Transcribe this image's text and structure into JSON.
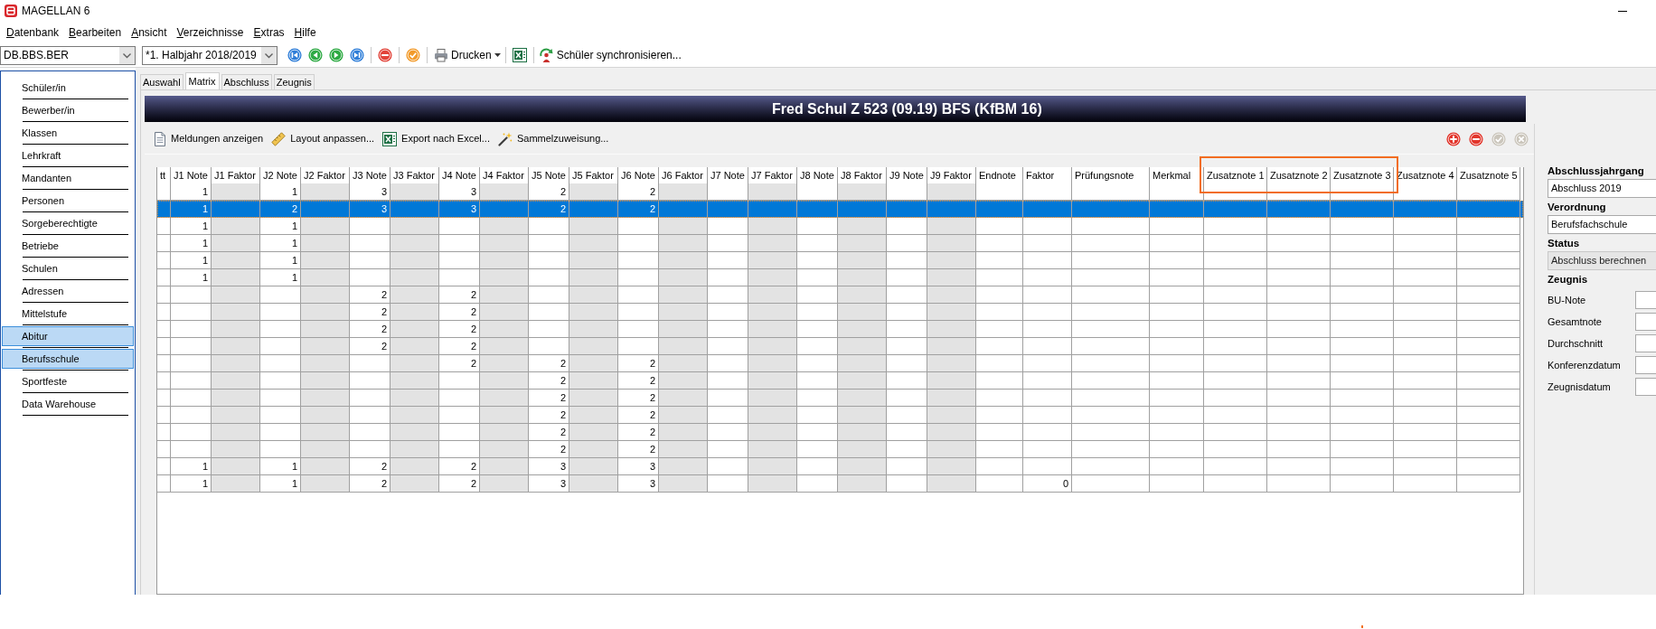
{
  "window": {
    "title": "MAGELLAN 6"
  },
  "menu": [
    "Datenbank",
    "Bearbeiten",
    "Ansicht",
    "Verzeichnisse",
    "Extras",
    "Hilfe"
  ],
  "toolbar": {
    "selects": [
      {
        "value": "DB.BBS.BER"
      },
      {
        "value": "*1. Halbjahr 2018/2019"
      }
    ],
    "buttons": [
      {
        "kind": "first"
      },
      {
        "kind": "previous"
      },
      {
        "kind": "next"
      },
      {
        "kind": "last"
      },
      {
        "kind": "stop"
      },
      {
        "kind": "confirm"
      },
      {
        "kind": "print",
        "label": "Drucken"
      },
      {
        "kind": "excel"
      },
      {
        "kind": "sync",
        "label": "Schüler synchronisieren..."
      }
    ]
  },
  "sidebar": {
    "items": [
      {
        "label": "Schüler/in",
        "selected": false
      },
      {
        "label": "Bewerber/in",
        "selected": false
      },
      {
        "label": "Klassen",
        "selected": false
      },
      {
        "label": "Lehrkraft",
        "selected": false
      },
      {
        "label": "Mandanten",
        "selected": false
      },
      {
        "label": "Personen",
        "selected": false
      },
      {
        "label": "Sorgeberechtigte",
        "selected": false
      },
      {
        "label": "Betriebe",
        "selected": false
      },
      {
        "label": "Schulen",
        "selected": false
      },
      {
        "label": "Adressen",
        "selected": false
      },
      {
        "label": "Mittelstufe",
        "selected": false
      },
      {
        "label": "Abitur",
        "selected": true
      },
      {
        "label": "Berufsschule",
        "selected": true
      },
      {
        "label": "Sportfeste",
        "selected": false
      },
      {
        "label": "Data Warehouse",
        "selected": false
      }
    ]
  },
  "tabs": [
    {
      "label": "Auswahl",
      "selected": false
    },
    {
      "label": "Matrix",
      "selected": true
    },
    {
      "label": "Abschluss",
      "selected": false
    },
    {
      "label": "Zeugnis",
      "selected": false
    }
  ],
  "header": {
    "title": "Fred Schul Z 523 (09.19) BFS (KfBM 16)"
  },
  "grid_toolbar": {
    "actions": [
      {
        "kind": "messages",
        "label": "Meldungen anzeigen"
      },
      {
        "kind": "layout",
        "label": "Layout anpassen..."
      },
      {
        "kind": "excel",
        "label": "Export nach Excel..."
      },
      {
        "kind": "assign",
        "label": "Sammelzuweisung..."
      }
    ],
    "row_buttons": [
      {
        "kind": "add",
        "disabled": false
      },
      {
        "kind": "remove",
        "disabled": false
      },
      {
        "kind": "confirm",
        "disabled": true
      },
      {
        "kind": "cancel",
        "disabled": true
      }
    ]
  },
  "grid": {
    "columns": [
      {
        "label": "tt",
        "shaded": false,
        "annotated": false
      },
      {
        "label": "J1 Note",
        "shaded": false,
        "annotated": false
      },
      {
        "label": "J1 Faktor",
        "shaded": true,
        "annotated": false
      },
      {
        "label": "J2 Note",
        "shaded": false,
        "annotated": false
      },
      {
        "label": "J2 Faktor",
        "shaded": true,
        "annotated": false
      },
      {
        "label": "J3 Note",
        "shaded": false,
        "annotated": false
      },
      {
        "label": "J3 Faktor",
        "shaded": true,
        "annotated": false
      },
      {
        "label": "J4 Note",
        "shaded": false,
        "annotated": false
      },
      {
        "label": "J4 Faktor",
        "shaded": true,
        "annotated": false
      },
      {
        "label": "J5 Note",
        "shaded": false,
        "annotated": false
      },
      {
        "label": "J5 Faktor",
        "shaded": true,
        "annotated": false
      },
      {
        "label": "J6 Note",
        "shaded": false,
        "annotated": false
      },
      {
        "label": "J6 Faktor",
        "shaded": true,
        "annotated": false
      },
      {
        "label": "J7 Note",
        "shaded": false,
        "annotated": false
      },
      {
        "label": "J7 Faktor",
        "shaded": true,
        "annotated": false
      },
      {
        "label": "J8 Note",
        "shaded": false,
        "annotated": false
      },
      {
        "label": "J8 Faktor",
        "shaded": true,
        "annotated": false
      },
      {
        "label": "J9 Note",
        "shaded": false,
        "annotated": false
      },
      {
        "label": "J9 Faktor",
        "shaded": true,
        "annotated": false
      },
      {
        "label": "Endnote",
        "shaded": false,
        "annotated": false
      },
      {
        "label": "Faktor",
        "shaded": false,
        "annotated": false
      },
      {
        "label": "Prüfungsnote",
        "shaded": false,
        "annotated": false
      },
      {
        "label": "Merkmal",
        "shaded": false,
        "annotated": false
      },
      {
        "label": "Zusatznote 1",
        "shaded": false,
        "annotated": true
      },
      {
        "label": "Zusatznote 2",
        "shaded": false,
        "annotated": true
      },
      {
        "label": "Zusatznote 3",
        "shaded": false,
        "annotated": true
      },
      {
        "label": "Zusatznote 4",
        "shaded": false,
        "annotated": false
      },
      {
        "label": "Zusatznote 5",
        "shaded": false,
        "annotated": false
      }
    ],
    "rows": [
      {
        "selected": false,
        "j1_note": "1",
        "j2_note": "1",
        "j3_note": "3",
        "j4_note": "3",
        "j5_note": "2",
        "j6_note": "2"
      },
      {
        "selected": true,
        "j1_note": "1",
        "j2_note": "2",
        "j3_note": "3",
        "j4_note": "3",
        "j5_note": "2",
        "j6_note": "2"
      },
      {
        "selected": false,
        "j1_note": "1",
        "j2_note": "1"
      },
      {
        "selected": false,
        "j1_note": "1",
        "j2_note": "1"
      },
      {
        "selected": false,
        "j1_note": "1",
        "j2_note": "1"
      },
      {
        "selected": false,
        "j1_note": "1",
        "j2_note": "1"
      },
      {
        "selected": false,
        "j3_note": "2",
        "j4_note": "2"
      },
      {
        "selected": false,
        "j3_note": "2",
        "j4_note": "2"
      },
      {
        "selected": false,
        "j3_note": "2",
        "j4_note": "2"
      },
      {
        "selected": false,
        "j3_note": "2",
        "j4_note": "2"
      },
      {
        "selected": false,
        "j4_note": "2",
        "j5_note": "2",
        "j6_note": "2"
      },
      {
        "selected": false,
        "j5_note": "2",
        "j6_note": "2"
      },
      {
        "selected": false,
        "j5_note": "2",
        "j6_note": "2"
      },
      {
        "selected": false,
        "j5_note": "2",
        "j6_note": "2"
      },
      {
        "selected": false,
        "j5_note": "2",
        "j6_note": "2"
      },
      {
        "selected": false,
        "j5_note": "2",
        "j6_note": "2"
      },
      {
        "selected": false,
        "j1_note": "1",
        "j2_note": "1",
        "j3_note": "2",
        "j4_note": "2",
        "j5_note": "3",
        "j6_note": "3"
      },
      {
        "selected": false,
        "j1_note": "1",
        "j2_note": "1",
        "j3_note": "2",
        "j4_note": "2",
        "j5_note": "3",
        "j6_note": "3",
        "faktor": "0"
      }
    ]
  },
  "details": {
    "fields": [
      {
        "label": "Abschlussjahrgang",
        "value": "Abschluss 2019",
        "disabled": false
      },
      {
        "label": "Verordnung",
        "value": "Berufsfachschule",
        "disabled": false
      },
      {
        "label": "Status",
        "value": "Abschluss berechnen",
        "disabled": true
      }
    ],
    "certificate": {
      "title": "Zeugnis",
      "fields": [
        {
          "label": "BU-Note"
        },
        {
          "label": "Gesamtnote"
        },
        {
          "label": "Durchschnitt"
        },
        {
          "label": "Konferenzdatum"
        },
        {
          "label": "Zeugnisdatum"
        }
      ]
    }
  }
}
